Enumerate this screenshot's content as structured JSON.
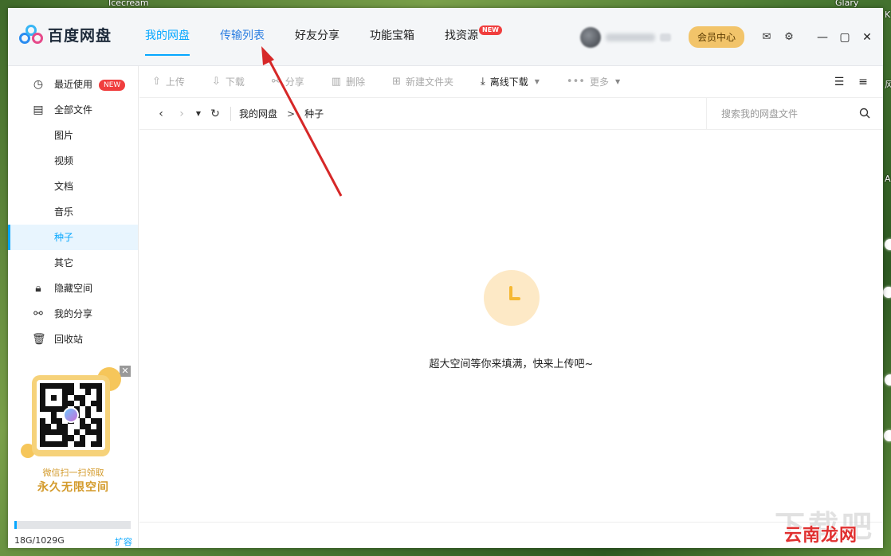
{
  "desktop": {
    "top_left_label": "Icecream",
    "top_right_label": "Glary",
    "right_edge_labels": [
      "K",
      "风",
      "A"
    ]
  },
  "app": {
    "name": "百度网盘",
    "accent": "#06a7ff"
  },
  "nav": {
    "items": [
      {
        "label": "我的网盘",
        "active": true
      },
      {
        "label": "传输列表",
        "active": false
      },
      {
        "label": "好友分享",
        "active": false
      },
      {
        "label": "功能宝箱",
        "active": false
      },
      {
        "label": "找资源",
        "active": false,
        "badge": "NEW"
      }
    ]
  },
  "header_right": {
    "vip_button": "会员中心",
    "icons": [
      "mail-icon",
      "settings-icon"
    ],
    "window_controls": [
      "minimize-icon",
      "maximize-icon",
      "close-icon"
    ]
  },
  "sidebar": {
    "items": [
      {
        "label": "最近使用",
        "icon": "clock-icon",
        "badge": "NEW"
      },
      {
        "label": "全部文件",
        "icon": "document-icon"
      },
      {
        "label": "图片"
      },
      {
        "label": "视频"
      },
      {
        "label": "文档"
      },
      {
        "label": "音乐"
      },
      {
        "label": "种子",
        "active": true
      },
      {
        "label": "其它"
      },
      {
        "label": "隐藏空间",
        "icon": "lock-icon"
      },
      {
        "label": "我的分享",
        "icon": "share-icon"
      },
      {
        "label": "回收站",
        "icon": "trash-icon"
      }
    ],
    "promo": {
      "close": "✕",
      "line1": "微信扫一扫领取",
      "line2": "永久无限空间"
    },
    "storage": {
      "text": "18G/1029G",
      "used_fraction": 0.0175,
      "expand": "扩容"
    }
  },
  "toolbar": {
    "upload": "上传",
    "download": "下载",
    "share": "分享",
    "delete": "删除",
    "new_folder": "新建文件夹",
    "offline_download": "离线下载",
    "more": "更多"
  },
  "pathbar": {
    "root": "我的网盘",
    "separator": ">",
    "current": "种子",
    "search_placeholder": "搜索我的网盘文件"
  },
  "content": {
    "empty_message": "超大空间等你来填满，快来上传吧~"
  },
  "watermark": {
    "text": "云南龙网",
    "faint": "下载吧"
  }
}
